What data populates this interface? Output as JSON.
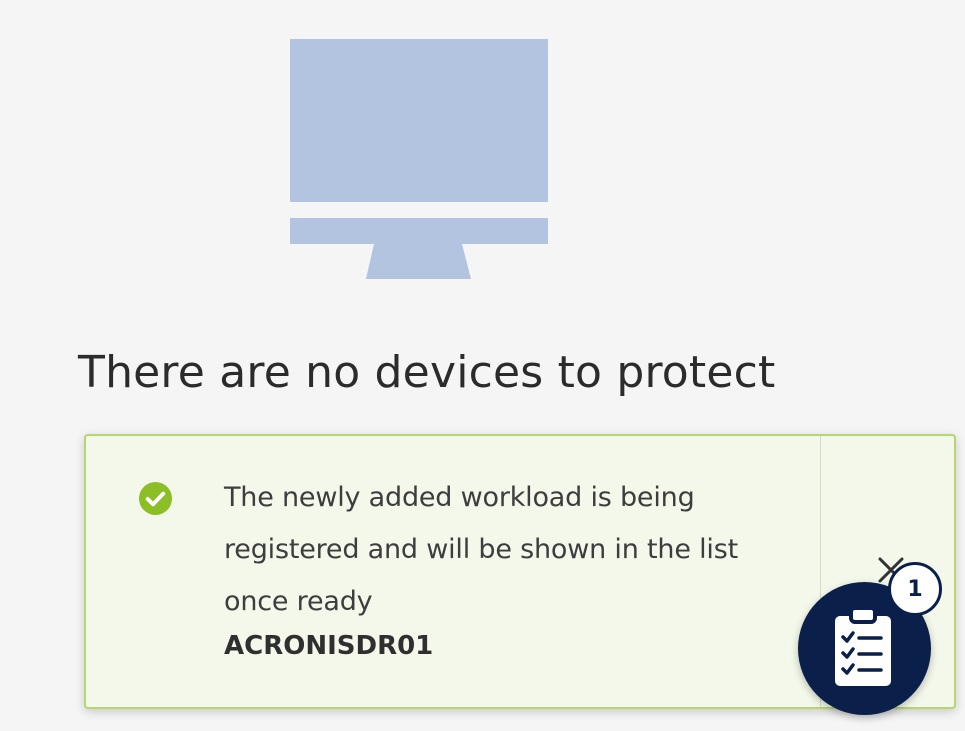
{
  "empty_state": {
    "title": "There are no devices to protect",
    "icon": "monitor-icon",
    "icon_color": "#b3c4e0"
  },
  "notification": {
    "type": "success",
    "message": "The newly added workload is being registered and will be shown in the list once ready",
    "device_name": "ACRONISDR01",
    "accent_color": "#8cbf26",
    "background_color": "#f3f8ea",
    "icons": {
      "status": "check-circle-icon",
      "dismiss": "close-icon"
    }
  },
  "tasks_button": {
    "icon": "clipboard-checklist-icon",
    "badge_count": "1",
    "color": "#0a1f4a"
  }
}
